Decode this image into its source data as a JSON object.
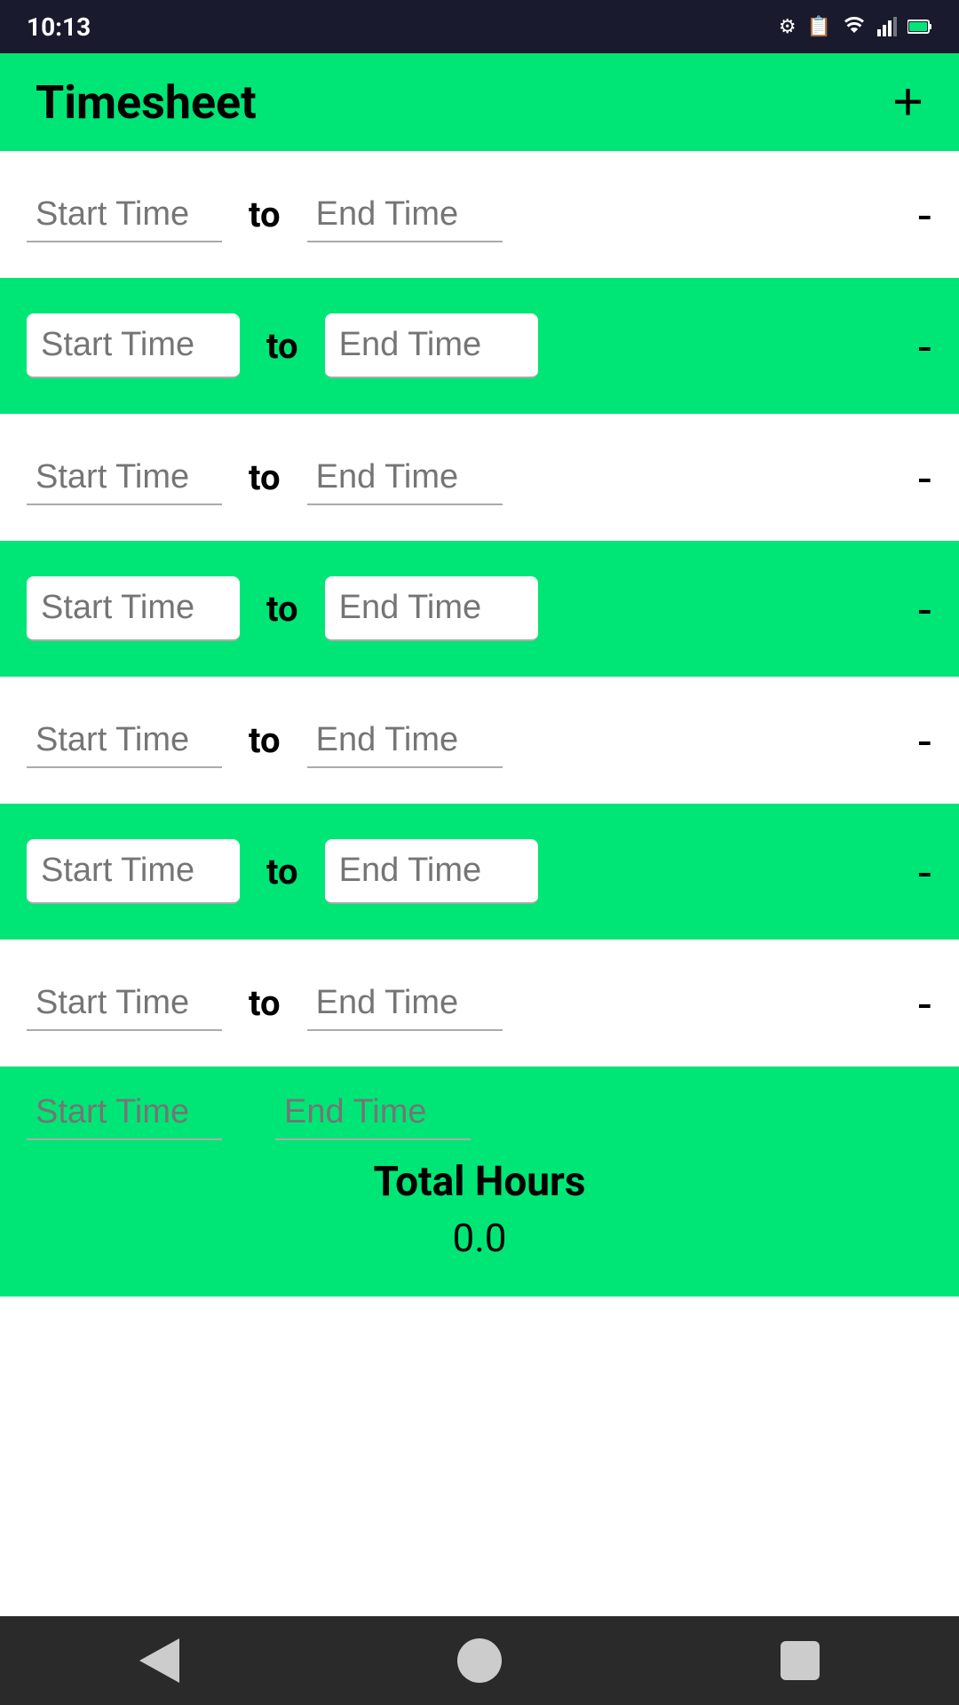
{
  "statusBar": {
    "time": "10:13",
    "icons": [
      "settings",
      "clipboard",
      "wifi",
      "signal",
      "battery"
    ]
  },
  "appBar": {
    "title": "Timesheet",
    "addButtonLabel": "+"
  },
  "rows": [
    {
      "id": 1,
      "bg": "white",
      "startPlaceholder": "Start Time",
      "toLabel": "to",
      "endPlaceholder": "End Time",
      "removeLabel": "-"
    },
    {
      "id": 2,
      "bg": "green",
      "startPlaceholder": "Start Time",
      "toLabel": "to",
      "endPlaceholder": "End Time",
      "removeLabel": "-"
    },
    {
      "id": 3,
      "bg": "white",
      "startPlaceholder": "Start Time",
      "toLabel": "to",
      "endPlaceholder": "End Time",
      "removeLabel": "-"
    },
    {
      "id": 4,
      "bg": "green",
      "startPlaceholder": "Start Time",
      "toLabel": "to",
      "endPlaceholder": "End Time",
      "removeLabel": "-"
    },
    {
      "id": 5,
      "bg": "white",
      "startPlaceholder": "Start Time",
      "toLabel": "to",
      "endPlaceholder": "End Time",
      "removeLabel": "-"
    },
    {
      "id": 6,
      "bg": "green",
      "startPlaceholder": "Start Time",
      "toLabel": "to",
      "endPlaceholder": "End Time",
      "removeLabel": "-"
    },
    {
      "id": 7,
      "bg": "white",
      "startPlaceholder": "Start Time",
      "toLabel": "to",
      "endPlaceholder": "End Time",
      "removeLabel": "-"
    }
  ],
  "footer": {
    "startPlaceholder": "Start Time",
    "endPlaceholder": "End Time",
    "totalLabel": "Total Hours",
    "totalValue": "0.0"
  },
  "navBar": {
    "backLabel": "back",
    "homeLabel": "home",
    "recentLabel": "recent"
  }
}
